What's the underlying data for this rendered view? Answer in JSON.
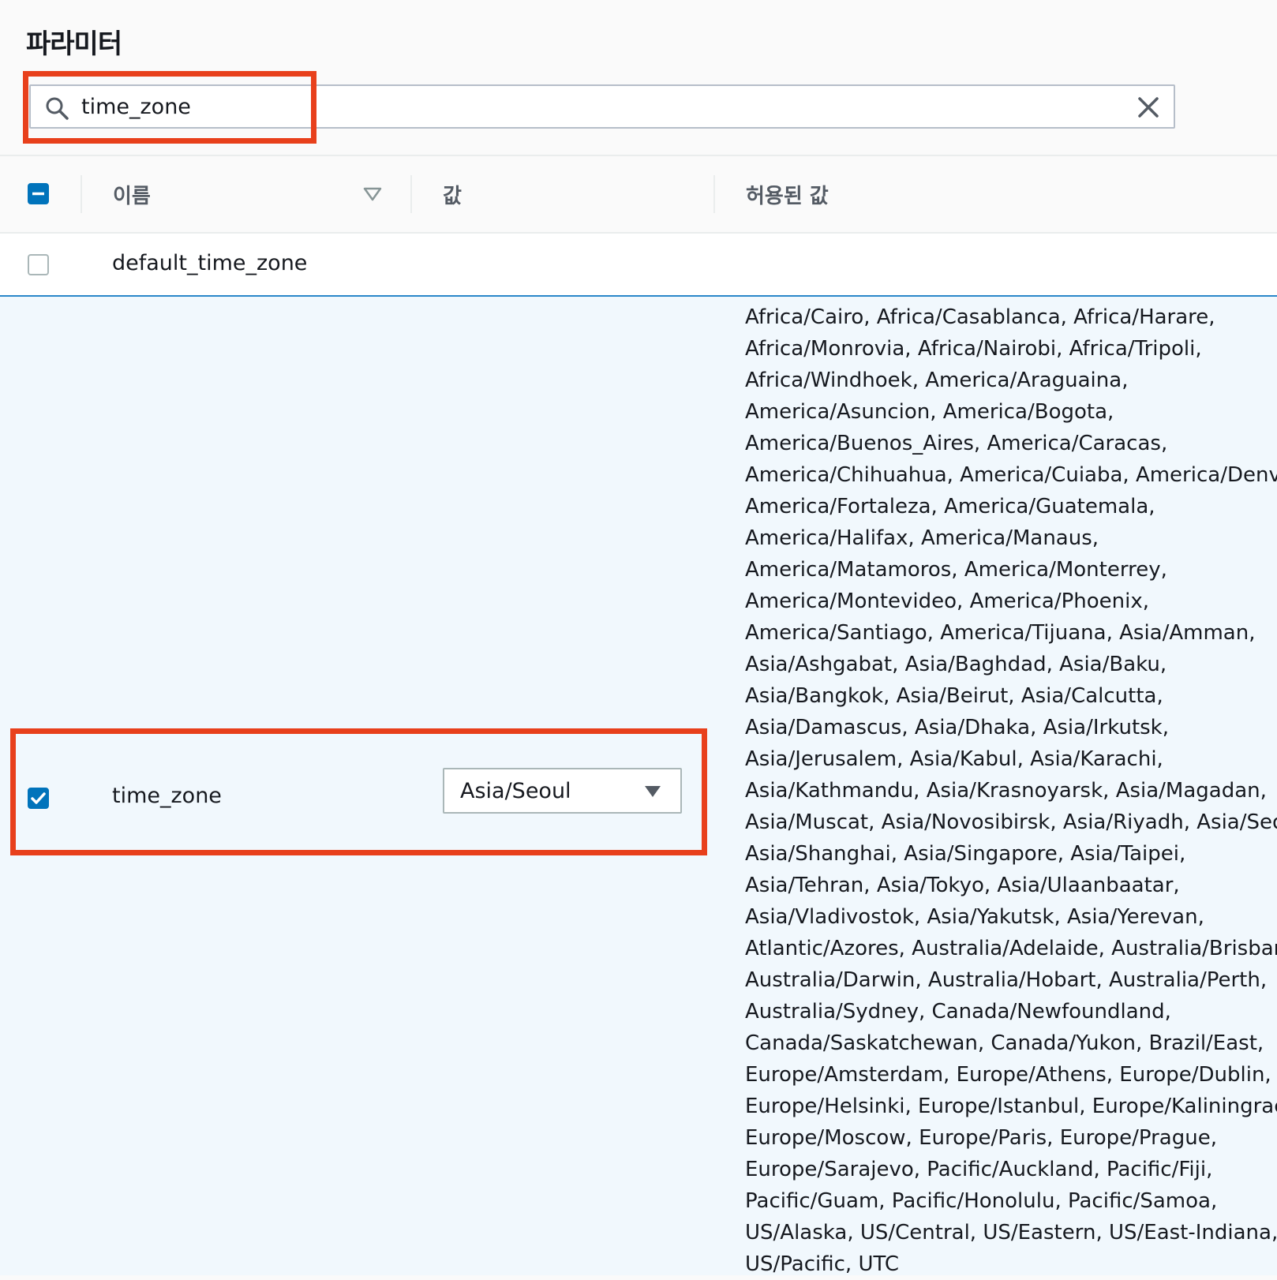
{
  "page": {
    "title": "파라미터"
  },
  "search": {
    "value": "time_zone"
  },
  "table": {
    "headers": {
      "name": "이름",
      "value": "값",
      "allowed": "허용된 값"
    },
    "rows": [
      {
        "name": "default_time_zone",
        "selected": false,
        "value": "",
        "allowed_lines": []
      },
      {
        "name": "time_zone",
        "selected": true,
        "value": "Asia/Seoul",
        "allowed_lines": [
          "Africa/Cairo, Africa/Casablanca, Africa/Harare,",
          "Africa/Monrovia, Africa/Nairobi, Africa/Tripoli,",
          "Africa/Windhoek, America/Araguaina,",
          "America/Asuncion, America/Bogota,",
          "America/Buenos_Aires, America/Caracas,",
          "America/Chihuahua, America/Cuiaba, America/Denve",
          "America/Fortaleza, America/Guatemala,",
          "America/Halifax, America/Manaus,",
          "America/Matamoros, America/Monterrey,",
          "America/Montevideo, America/Phoenix,",
          "America/Santiago, America/Tijuana, Asia/Amman,",
          "Asia/Ashgabat, Asia/Baghdad, Asia/Baku,",
          "Asia/Bangkok, Asia/Beirut, Asia/Calcutta,",
          "Asia/Damascus, Asia/Dhaka, Asia/Irkutsk,",
          "Asia/Jerusalem, Asia/Kabul, Asia/Karachi,",
          "Asia/Kathmandu, Asia/Krasnoyarsk, Asia/Magadan,",
          "Asia/Muscat, Asia/Novosibirsk, Asia/Riyadh, Asia/Seo",
          "Asia/Shanghai, Asia/Singapore, Asia/Taipei,",
          "Asia/Tehran, Asia/Tokyo, Asia/Ulaanbaatar,",
          "Asia/Vladivostok, Asia/Yakutsk, Asia/Yerevan,",
          "Atlantic/Azores, Australia/Adelaide, Australia/Brisban",
          "Australia/Darwin, Australia/Hobart, Australia/Perth,",
          "Australia/Sydney, Canada/Newfoundland,",
          "Canada/Saskatchewan, Canada/Yukon, Brazil/East,",
          "Europe/Amsterdam, Europe/Athens, Europe/Dublin,",
          "Europe/Helsinki, Europe/Istanbul, Europe/Kaliningrac",
          "Europe/Moscow, Europe/Paris, Europe/Prague,",
          "Europe/Sarajevo, Pacific/Auckland, Pacific/Fiji,",
          "Pacific/Guam, Pacific/Honolulu, Pacific/Samoa,",
          "US/Alaska, US/Central, US/Eastern, US/East-Indiana,",
          "US/Pacific, UTC"
        ]
      }
    ]
  },
  "colors": {
    "highlight": "#e8401c",
    "accent": "#0073bb",
    "selected_row_bg": "#f1f8fd"
  }
}
